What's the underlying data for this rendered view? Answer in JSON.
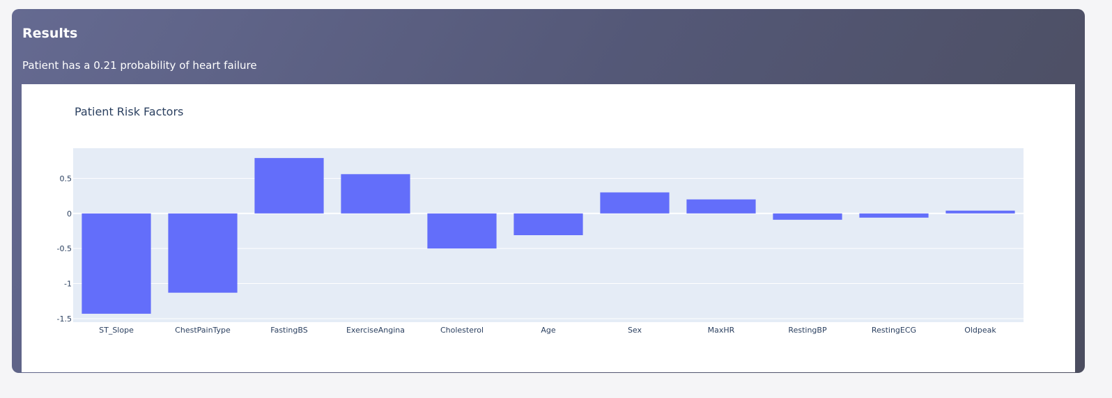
{
  "card": {
    "title": "Results",
    "summary": "Patient has a 0.21 probability of heart failure"
  },
  "colors": {
    "bar": "#636efa",
    "plot_bg": "#e5ecf6",
    "grid": "#ffffff",
    "text": "#2a3f5f"
  },
  "chart_data": {
    "type": "bar",
    "title": "Patient Risk Factors",
    "xlabel": "",
    "ylabel": "",
    "categories": [
      "ST_Slope",
      "ChestPainType",
      "FastingBS",
      "ExerciseAngina",
      "Cholesterol",
      "Age",
      "Sex",
      "MaxHR",
      "RestingBP",
      "RestingECG",
      "Oldpeak"
    ],
    "values": [
      -1.43,
      -1.13,
      0.79,
      0.56,
      -0.5,
      -0.31,
      0.3,
      0.2,
      -0.09,
      -0.06,
      0.04
    ],
    "ylim": [
      -1.55,
      0.93
    ],
    "yticks": [
      0.5,
      0,
      -0.5,
      -1,
      -1.5
    ],
    "ytick_labels": [
      "0.5",
      "0",
      "-0.5",
      "-1",
      "-1.5"
    ],
    "grid": true,
    "legend": "none"
  }
}
